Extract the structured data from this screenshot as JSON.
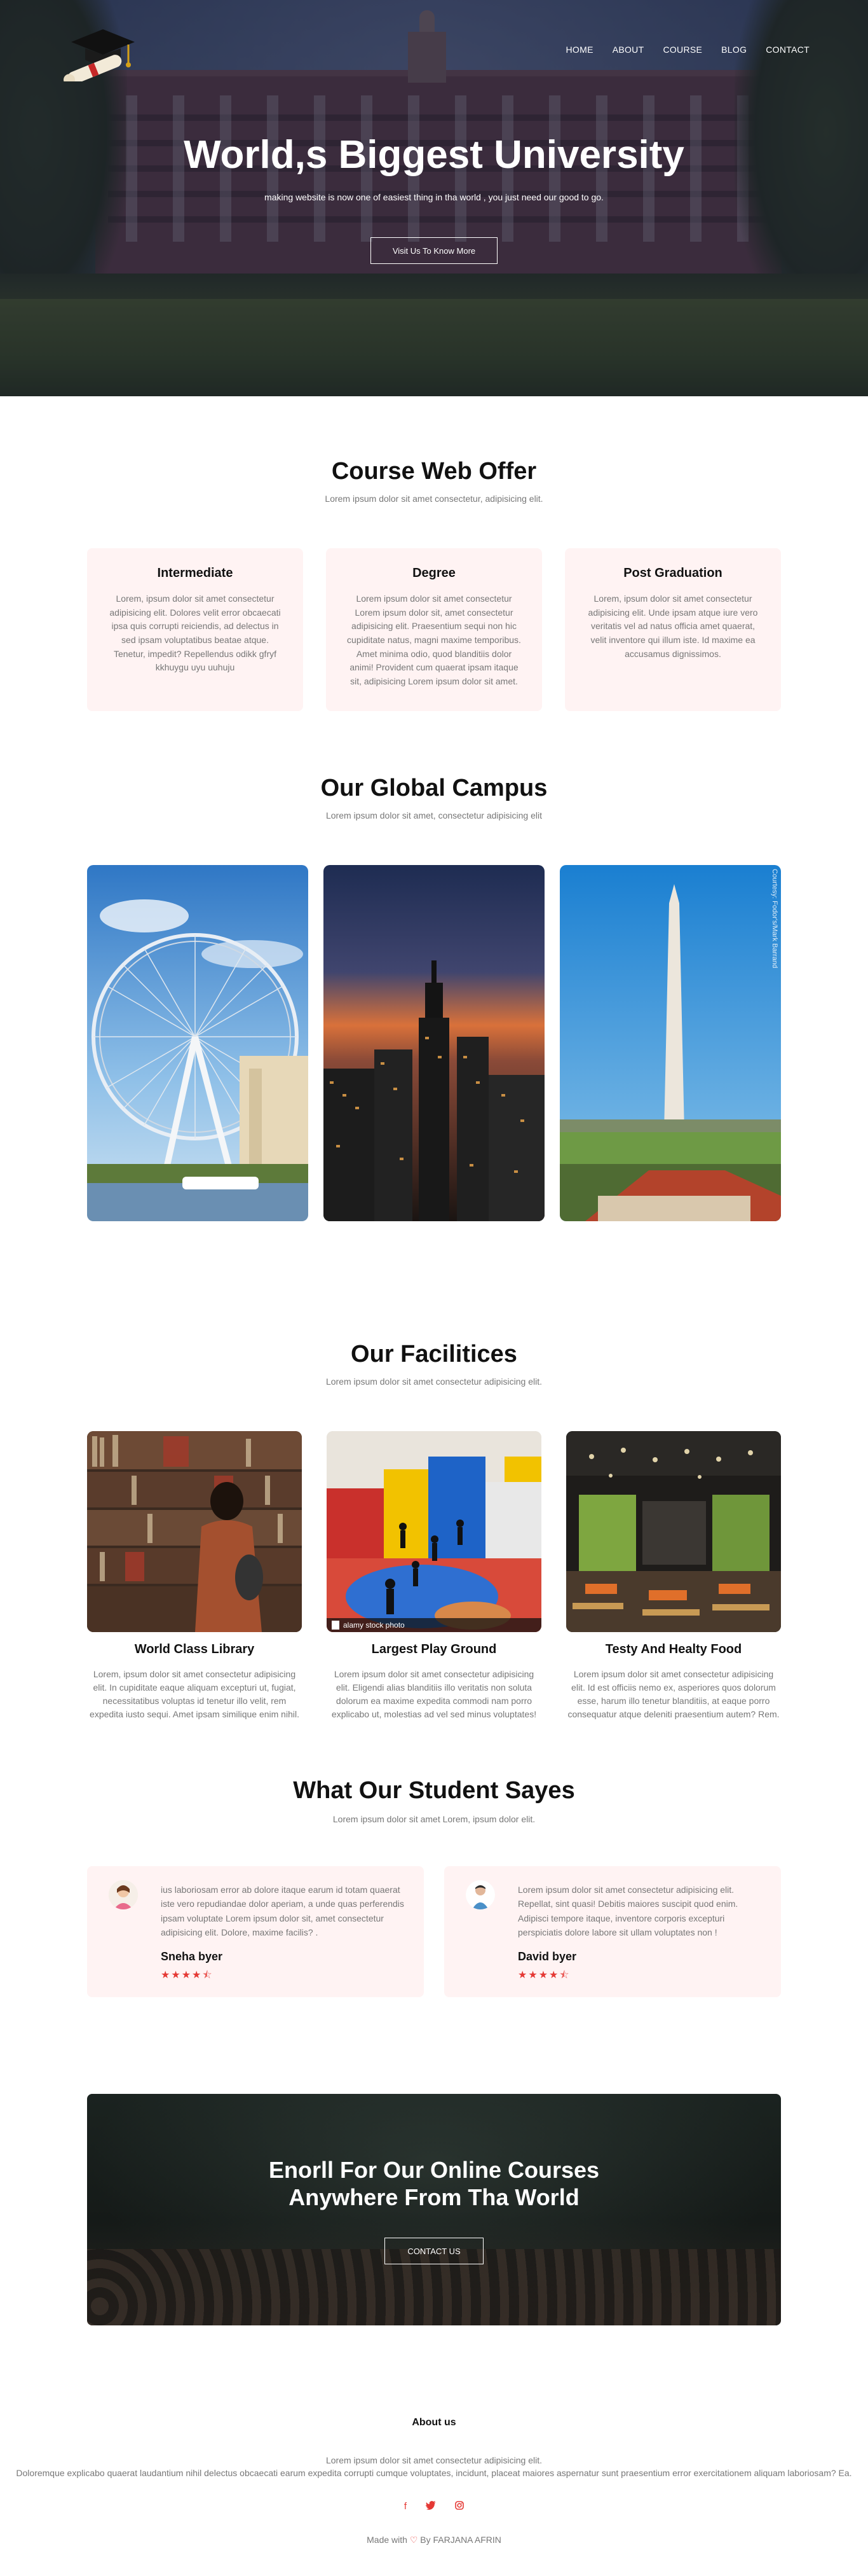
{
  "nav": {
    "items": [
      "HOME",
      "ABOUT",
      "COURSE",
      "BLOG",
      "CONTACT"
    ]
  },
  "hero": {
    "title": "World,s Biggest University",
    "subtitle": "making website is now one of easiest thing in tha world , you just need our good to go.",
    "button": "Visit Us To Know More"
  },
  "courses": {
    "title": "Course Web Offer",
    "subtitle": "Lorem ipsum dolor sit amet consectetur, adipisicing elit.",
    "items": [
      {
        "title": "Intermediate",
        "text": "Lorem, ipsum dolor sit amet consectetur adipisicing elit. Dolores velit error obcaecati ipsa quis corrupti reiciendis, ad delectus in sed ipsam voluptatibus beatae atque. Tenetur, impedit? Repellendus odikk gfryf kkhuygu uyu uuhuju"
      },
      {
        "title": "Degree",
        "text": "Lorem ipsum dolor sit amet consectetur Lorem ipsum dolor sit, amet consectetur adipisicing elit. Praesentium sequi non hic cupiditate natus, magni maxime temporibus. Amet minima odio, quod blanditiis dolor animi! Provident cum quaerat ipsam itaque sit, adipisicing Lorem ipsum dolor sit amet."
      },
      {
        "title": "Post Graduation",
        "text": "Lorem, ipsum dolor sit amet consectetur adipisicing elit. Unde ipsam atque iure vero veritatis vel ad natus officia amet quaerat, velit inventore qui illum iste. Id maxime ea accusamus dignissimos."
      }
    ]
  },
  "campus": {
    "title": "Our Global Campus",
    "subtitle": "Lorem ipsum dolor sit amet, consectetur adipisicing elit",
    "photo_credit": "Courtesy: Fodor's/Mark Barrand"
  },
  "facilities": {
    "title": "Our Facilitices",
    "subtitle": "Lorem ipsum dolor sit amet consectetur adipisicing elit.",
    "photo_watermark": "alamy stock photo",
    "items": [
      {
        "title": "World Class Library",
        "text": "Lorem, ipsum dolor sit amet consectetur adipisicing elit. In cupiditate eaque aliquam excepturi ut, fugiat, necessitatibus voluptas id tenetur illo velit, rem expedita iusto sequi. Amet ipsam similique enim nihil."
      },
      {
        "title": "Largest Play Ground",
        "text": "Lorem ipsum dolor sit amet consectetur adipisicing elit. Eligendi alias blanditiis illo veritatis non soluta dolorum ea maxime expedita commodi nam porro explicabo ut, molestias ad vel sed minus voluptates!"
      },
      {
        "title": "Testy And Healty Food",
        "text": "Lorem ipsum dolor sit amet consectetur adipisicing elit. Id est officiis nemo ex, asperiores quos dolorum esse, harum illo tenetur blanditiis, at eaque porro consequatur atque deleniti praesentium autem? Rem."
      }
    ]
  },
  "testimonials": {
    "title": "What Our Student Sayes",
    "subtitle": "Lorem ipsum dolor sit amet Lorem, ipsum dolor elit.",
    "items": [
      {
        "text": "ius laboriosam error ab dolore itaque earum id totam quaerat iste vero repudiandae dolor aperiam, a unde quas perferendis ipsam voluptate Lorem ipsum dolor sit, amet consectetur adipisicing elit. Dolore, maxime facilis? .",
        "name": "Sneha byer",
        "rating": 4.5
      },
      {
        "text": "Lorem ipsum dolor sit amet consectetur adipisicing elit. Repellat, sint quasi! Debitis maiores suscipit quod enim. Adipisci tempore itaque, inventore corporis excepturi perspiciatis dolore labore sit ullam voluptates non !",
        "name": "David byer",
        "rating": 4.5
      }
    ]
  },
  "cta": {
    "title_line1": "Enorll For Our Online Courses",
    "title_line2": "Anywhere From Tha World",
    "button": "CONTACT US"
  },
  "footer": {
    "title": "About us",
    "line1": "Lorem ipsum dolor sit amet consectetur adipisicing elit.",
    "line2": "Doloremque explicabo quaerat laudantium nihil delectus obcaecati earum expedita corrupti cumque voluptates, incidunt, placeat maiores aspernatur sunt praesentium error exercitationem aliquam laboriosam? Ea.",
    "socials": [
      "facebook-icon",
      "twitter-icon",
      "instagram-icon"
    ],
    "made_with_prefix": "Made with",
    "made_with_suffix": "By FARJANA AFRIN"
  },
  "colors": {
    "accent": "#e53935",
    "card_bg": "#fff3f3",
    "muted_text": "#777777"
  }
}
